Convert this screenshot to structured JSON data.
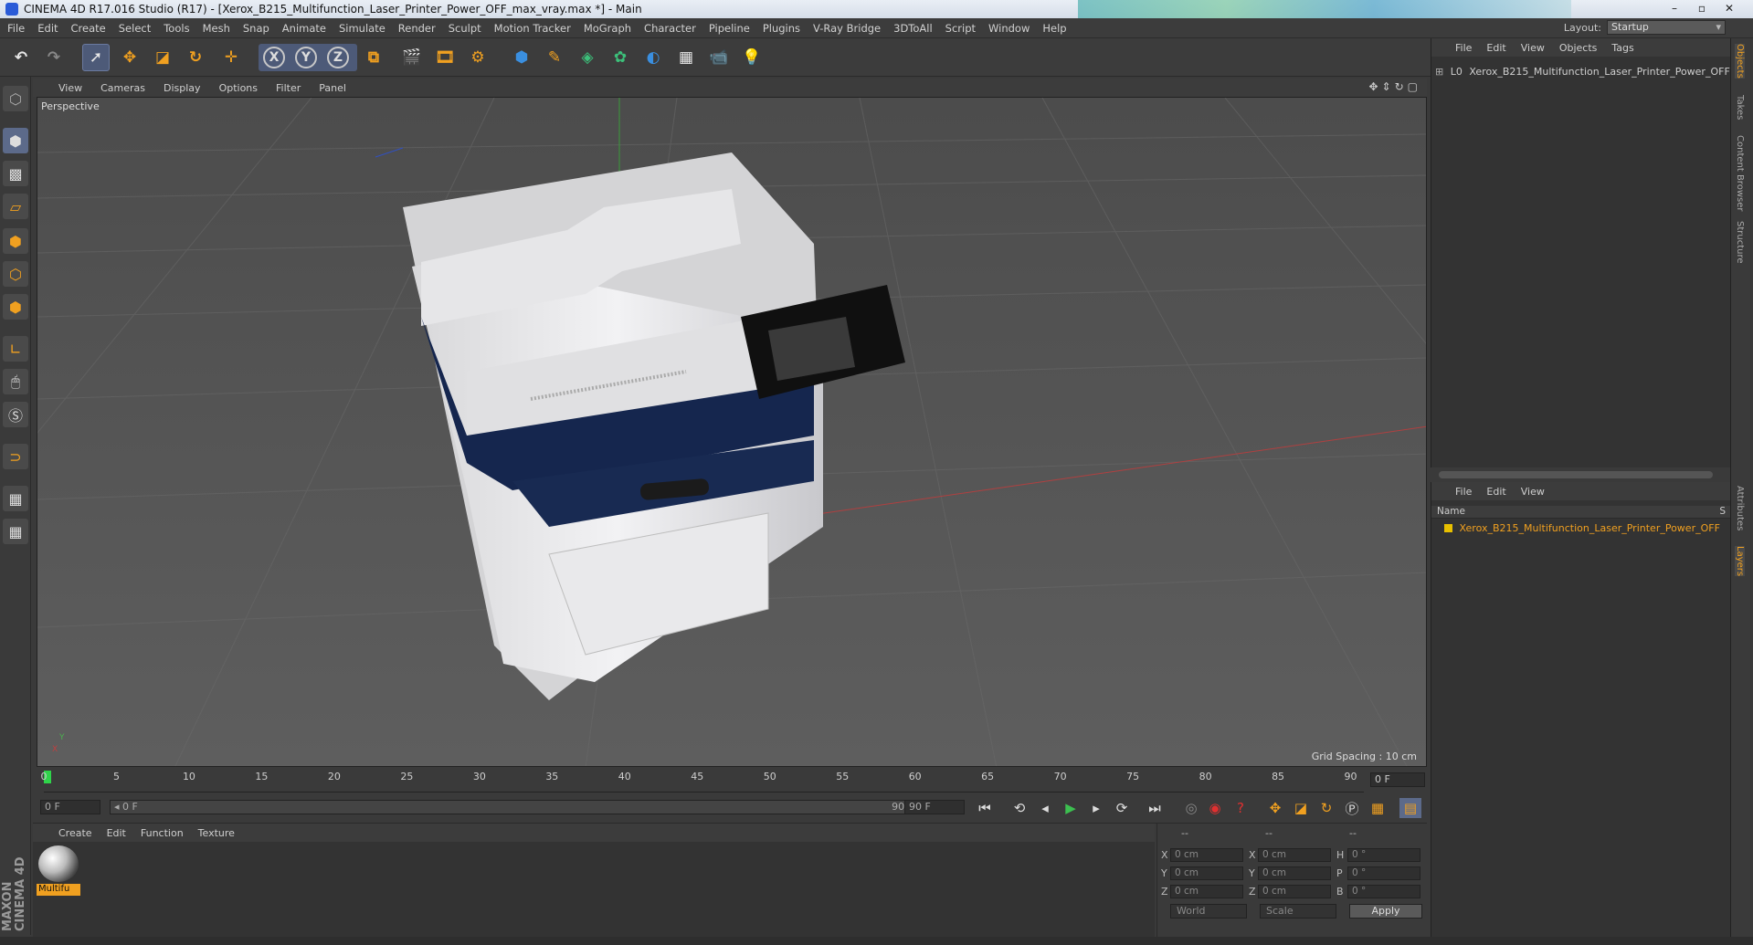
{
  "window": {
    "title": "CINEMA 4D R17.016 Studio (R17) - [Xerox_B215_Multifunction_Laser_Printer_Power_OFF_max_vray.max *] - Main",
    "controls": [
      "–",
      "▫",
      "✕"
    ]
  },
  "menubar": {
    "items": [
      "File",
      "Edit",
      "Create",
      "Select",
      "Tools",
      "Mesh",
      "Snap",
      "Animate",
      "Simulate",
      "Render",
      "Sculpt",
      "Motion Tracker",
      "MoGraph",
      "Character",
      "Pipeline",
      "Plugins",
      "V-Ray Bridge",
      "3DToAll",
      "Script",
      "Window",
      "Help"
    ],
    "layout_label": "Layout:",
    "layout_value": "Startup"
  },
  "toolbar": {
    "axis_x": "X",
    "axis_y": "Y",
    "axis_z": "Z"
  },
  "viewport": {
    "menu": [
      "View",
      "Cameras",
      "Display",
      "Options",
      "Filter",
      "Panel"
    ],
    "label": "Perspective",
    "grid_spacing": "Grid Spacing : 10 cm",
    "axis_y": "Y",
    "axis_x": "X"
  },
  "timeline": {
    "ticks": [
      "0",
      "5",
      "10",
      "15",
      "20",
      "25",
      "30",
      "35",
      "40",
      "45",
      "50",
      "55",
      "60",
      "65",
      "70",
      "75",
      "80",
      "85",
      "90"
    ],
    "current_frame": "0 F",
    "start_field": "0 F",
    "range_start": "◂ 0 F",
    "range_end": "90 F ▸",
    "end_field": "90 F"
  },
  "material_manager": {
    "menu": [
      "Create",
      "Edit",
      "Function",
      "Texture"
    ],
    "material_name": "Multifu"
  },
  "coordinates": {
    "headers": [
      "--",
      "--",
      "--"
    ],
    "rows": [
      {
        "a": "X",
        "av": "0 cm",
        "b": "X",
        "bv": "0 cm",
        "c": "H",
        "cv": "0 °"
      },
      {
        "a": "Y",
        "av": "0 cm",
        "b": "Y",
        "bv": "0 cm",
        "c": "P",
        "cv": "0 °"
      },
      {
        "a": "Z",
        "av": "0 cm",
        "b": "Z",
        "bv": "0 cm",
        "c": "B",
        "cv": "0 °"
      }
    ],
    "mode": "World",
    "mode2": "Scale",
    "apply": "Apply"
  },
  "object_manager": {
    "menu": [
      "File",
      "Edit",
      "View",
      "Objects",
      "Tags"
    ],
    "object_name": "Xerox_B215_Multifunction_Laser_Printer_Power_OFF"
  },
  "layer_manager": {
    "menu": [
      "File",
      "Edit",
      "View"
    ],
    "column_name": "Name",
    "column_s": "S",
    "layer_name": "Xerox_B215_Multifunction_Laser_Printer_Power_OFF",
    "layer_color": "#e8c000"
  },
  "right_tabs": [
    "Objects",
    "Takes",
    "Content Browser",
    "Structure",
    "Attributes",
    "Layers"
  ],
  "branding": "MAXON CINEMA 4D",
  "colors": {
    "accent": "#f0a020",
    "selection": "#4d5a78"
  }
}
